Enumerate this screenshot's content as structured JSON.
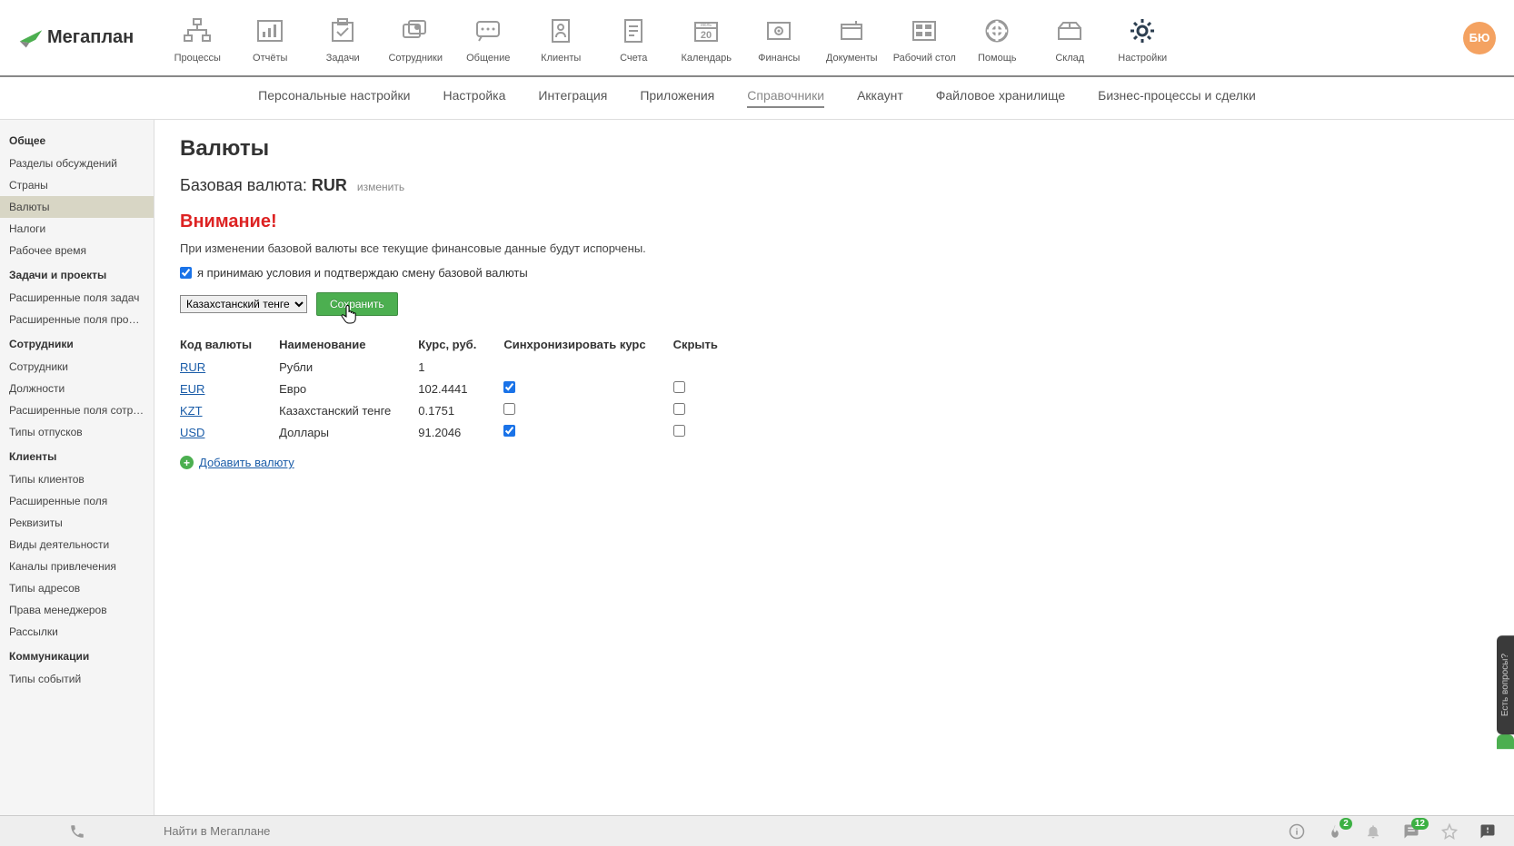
{
  "logo": {
    "text": "Мегаплан"
  },
  "avatar": "БЮ",
  "topnav": [
    {
      "label": "Процессы"
    },
    {
      "label": "Отчёты"
    },
    {
      "label": "Задачи"
    },
    {
      "label": "Сотрудники"
    },
    {
      "label": "Общение"
    },
    {
      "label": "Клиенты"
    },
    {
      "label": "Счета"
    },
    {
      "label": "Календарь"
    },
    {
      "label": "Финансы"
    },
    {
      "label": "Документы"
    },
    {
      "label": "Рабочий стол"
    },
    {
      "label": "Помощь"
    },
    {
      "label": "Склад"
    },
    {
      "label": "Настройки"
    }
  ],
  "calendar_icon": {
    "month": "июль",
    "day": "20"
  },
  "subnav": [
    {
      "label": "Персональные настройки"
    },
    {
      "label": "Настройка"
    },
    {
      "label": "Интеграция"
    },
    {
      "label": "Приложения"
    },
    {
      "label": "Справочники",
      "active": true
    },
    {
      "label": "Аккаунт"
    },
    {
      "label": "Файловое хранилище"
    },
    {
      "label": "Бизнес-процессы и сделки"
    }
  ],
  "sidebar": [
    {
      "type": "group",
      "label": "Общее"
    },
    {
      "type": "item",
      "label": "Разделы обсуждений"
    },
    {
      "type": "item",
      "label": "Страны"
    },
    {
      "type": "item",
      "label": "Валюты",
      "active": true
    },
    {
      "type": "item",
      "label": "Налоги"
    },
    {
      "type": "item",
      "label": "Рабочее время"
    },
    {
      "type": "group",
      "label": "Задачи и проекты"
    },
    {
      "type": "item",
      "label": "Расширенные поля задач"
    },
    {
      "type": "item",
      "label": "Расширенные поля проек..."
    },
    {
      "type": "group",
      "label": "Сотрудники"
    },
    {
      "type": "item",
      "label": "Сотрудники"
    },
    {
      "type": "item",
      "label": "Должности"
    },
    {
      "type": "item",
      "label": "Расширенные поля сотру..."
    },
    {
      "type": "item",
      "label": "Типы отпусков"
    },
    {
      "type": "group",
      "label": "Клиенты"
    },
    {
      "type": "item",
      "label": "Типы клиентов"
    },
    {
      "type": "item",
      "label": "Расширенные поля"
    },
    {
      "type": "item",
      "label": "Реквизиты"
    },
    {
      "type": "item",
      "label": "Виды деятельности"
    },
    {
      "type": "item",
      "label": "Каналы привлечения"
    },
    {
      "type": "item",
      "label": "Типы адресов"
    },
    {
      "type": "item",
      "label": "Права менеджеров"
    },
    {
      "type": "item",
      "label": "Рассылки"
    },
    {
      "type": "group",
      "label": "Коммуникации"
    },
    {
      "type": "item",
      "label": "Типы событий"
    }
  ],
  "page": {
    "title": "Валюты",
    "base_label": "Базовая валюта: ",
    "base_value": "RUR",
    "change": "изменить",
    "warning_title": "Внимание!",
    "warning_text": "При изменении базовой валюты все текущие финансовые данные будут испорчены.",
    "accept_label": "я принимаю условия и подтверждаю смену базовой валюты",
    "select_value": "Казахстанский тенге",
    "save_btn": "Сохранить",
    "add_currency": "Добавить валюту"
  },
  "table": {
    "headers": {
      "code": "Код валюты",
      "name": "Наименование",
      "rate": "Курс, руб.",
      "sync": "Синхронизировать курс",
      "hide": "Скрыть"
    },
    "rows": [
      {
        "code": "RUR",
        "name": "Рубли",
        "rate": "1",
        "sync": null,
        "hide": null
      },
      {
        "code": "EUR",
        "name": "Евро",
        "rate": "102.4441",
        "sync": true,
        "hide": false
      },
      {
        "code": "KZT",
        "name": "Казахстанский тенге",
        "rate": "0.1751",
        "sync": false,
        "hide": false
      },
      {
        "code": "USD",
        "name": "Доллары",
        "rate": "91.2046",
        "sync": true,
        "hide": false
      }
    ]
  },
  "footer": {
    "search_placeholder": "Найти в Мегаплане",
    "badge_fire": "2",
    "badge_chat": "12"
  },
  "side_tab": "Есть вопросы?"
}
